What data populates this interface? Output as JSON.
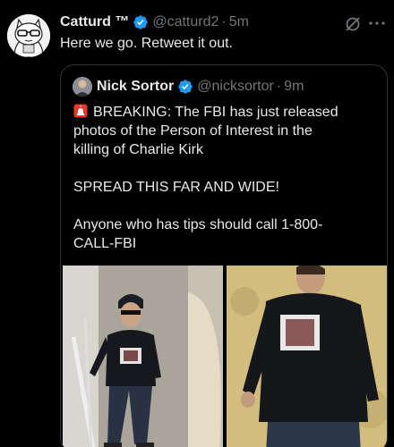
{
  "tweet": {
    "author_name": "Catturd ™",
    "author_handle": "@catturd2",
    "separator": "·",
    "time": "5m",
    "text": "Here we go. Retweet it out."
  },
  "quote": {
    "author_name": "Nick Sortor",
    "author_handle": "@nicksortor",
    "separator": "·",
    "time": "9m",
    "line1": "BREAKING: The FBI has just released",
    "line2": "photos of the Person of Interest in the",
    "line3": "killing of Charlie Kirk",
    "line4": "SPREAD THIS FAR AND WIDE!",
    "line5": "Anyone who has tips should call 1-800-",
    "line6": "CALL-FBI"
  },
  "icons": {
    "verified": "verified-badge-icon",
    "grok": "grok-icon",
    "more": "more-options-icon",
    "siren": "siren-emoji-icon"
  },
  "colors": {
    "background": "#000000",
    "text": "#e7e9ea",
    "muted": "#71767b",
    "verified": "#1d9bf0",
    "border": "#2f3336"
  }
}
